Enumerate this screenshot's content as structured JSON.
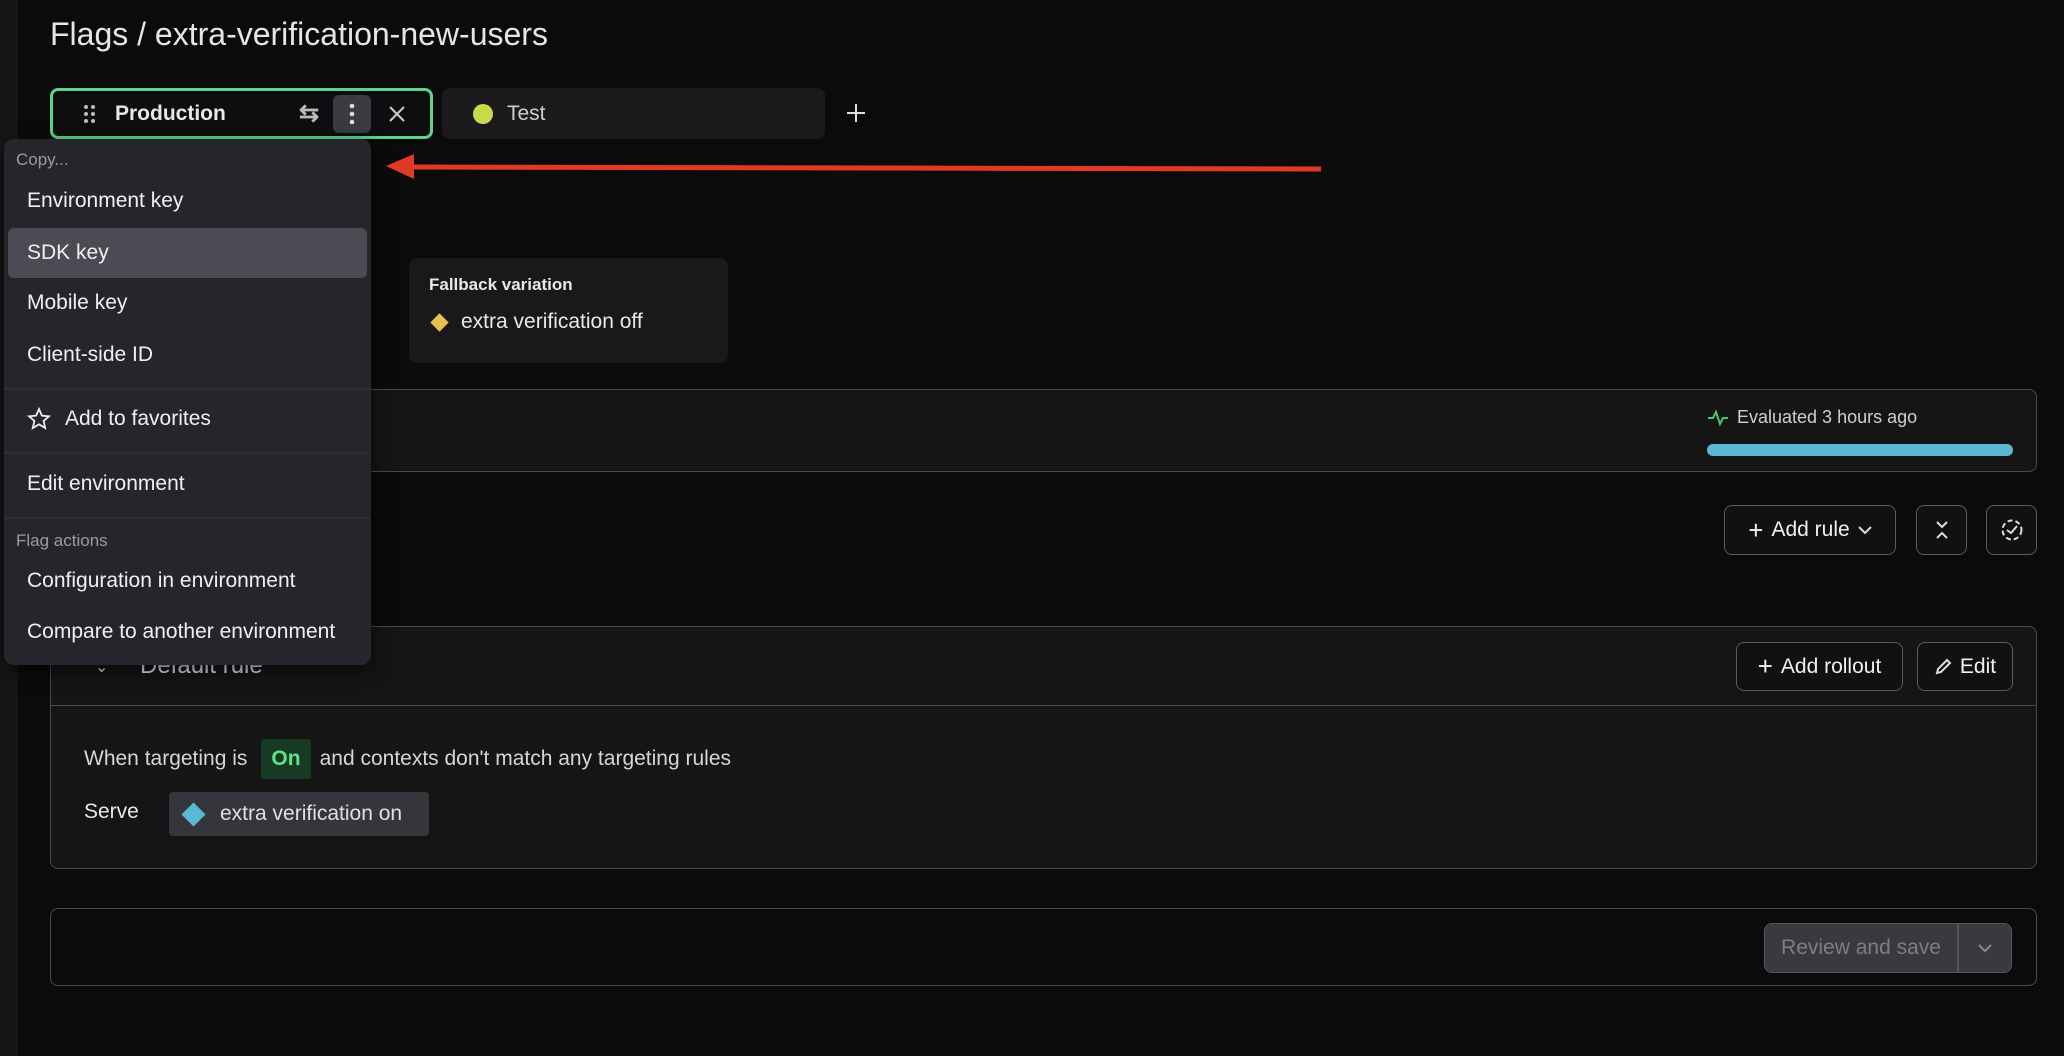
{
  "header": {
    "title": "Flags / extra-verification-new-users"
  },
  "tabs": [
    {
      "label": "Production",
      "accent": "#5fd38a"
    },
    {
      "label": "Test",
      "dot_color": "#c9d94a"
    }
  ],
  "menu": {
    "copy_header": "Copy...",
    "copy_items": [
      "Environment key",
      "SDK key",
      "Mobile key",
      "Client-side ID"
    ],
    "highlighted": "SDK key",
    "favorites": "Add to favorites",
    "edit": "Edit environment",
    "flag_actions_header": "Flag actions",
    "flag_actions": [
      "Configuration in environment",
      "Compare to another environment"
    ]
  },
  "annotation": {
    "arrow_color": "#e03a26"
  },
  "fallback": {
    "title": "Fallback variation",
    "value": "extra verification off",
    "color": "#e8c04a"
  },
  "evaluation": {
    "text": "Evaluated 3 hours ago",
    "bar_fill_percent": 100,
    "bar_color": "#5ab8d3",
    "icon": "activity-icon"
  },
  "toolbar": {
    "add_rule": "Add rule"
  },
  "default_rule": {
    "title": "Default rule",
    "add_rollout": "Add rollout",
    "edit": "Edit",
    "when_prefix": "When targeting is",
    "state": "On",
    "when_suffix": "and contexts don't match any targeting rules",
    "serve_label": "Serve",
    "serve_value": "extra verification on",
    "serve_color": "#5ab8d3"
  },
  "footer": {
    "review_save": "Review and save"
  }
}
